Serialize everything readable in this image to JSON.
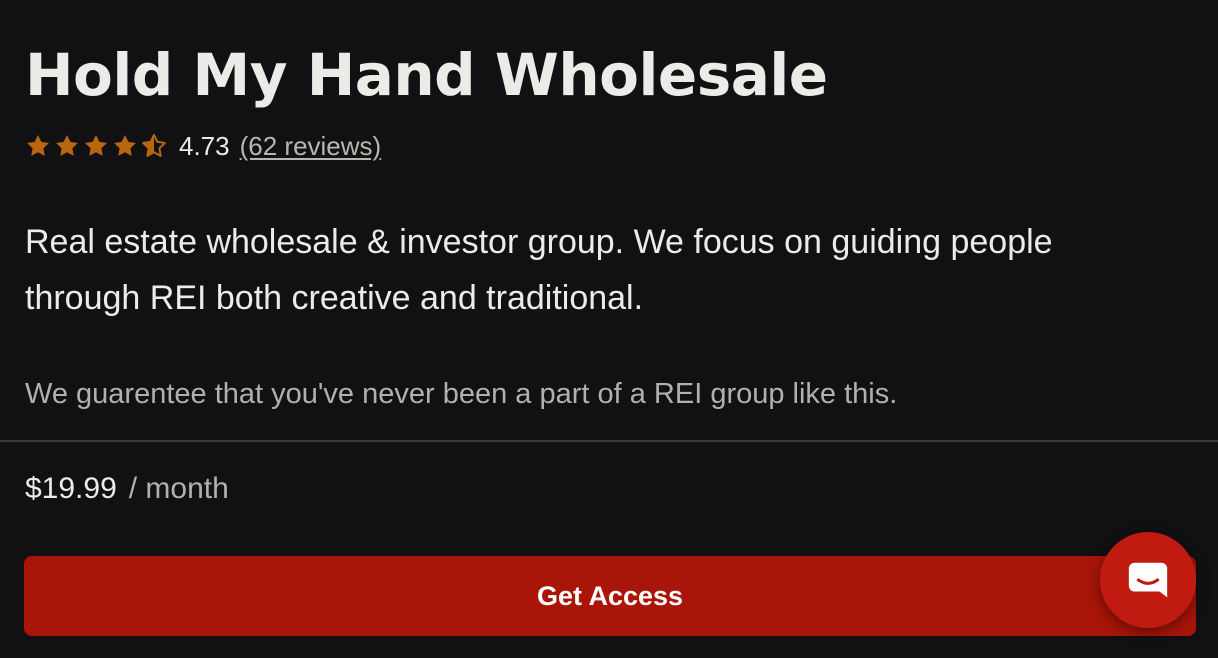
{
  "group": {
    "title": "Hold My Hand Wholesale",
    "rating_value": "4.73",
    "rating_stars": 4.73,
    "reviews_label": "(62 reviews)",
    "description": "Real estate wholesale & investor group. We focus on guiding people through REI both creative and traditional.",
    "tagline": "We guarentee that you've never been a part of a REI group like this."
  },
  "pricing": {
    "price": "$19.99",
    "period": "/ month"
  },
  "cta": {
    "label": "Get Access"
  },
  "icons": {
    "star": "star-icon",
    "chat": "chat-bubble-icon"
  },
  "colors": {
    "background": "#111113",
    "star": "#b9660f",
    "cta": "#a91508",
    "chat_launcher": "#c11a10"
  }
}
